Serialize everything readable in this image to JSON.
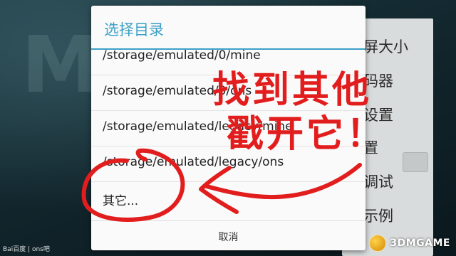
{
  "background_app": {
    "logo_text": "M",
    "panel_items": [
      "屏大小",
      "码器",
      "设置",
      "置",
      "调试",
      "示例"
    ]
  },
  "dialog": {
    "title": "选择目录",
    "items": [
      "/storage/emulated/0/mine",
      "/storage/emulated/0/ons",
      "/storage/emulated/legacy/mine",
      "/storage/emulated/legacy/ons",
      "其它..."
    ],
    "cancel_label": "取消"
  },
  "annotation": {
    "line1": "找到其他",
    "line2": "戳开它！",
    "color": "#e21d1d"
  },
  "watermarks": {
    "left": "Bai百度 | ons吧",
    "right": "3DMGAME"
  },
  "colors": {
    "accent": "#3aa0c6",
    "annotation_red": "#e21d1d"
  }
}
